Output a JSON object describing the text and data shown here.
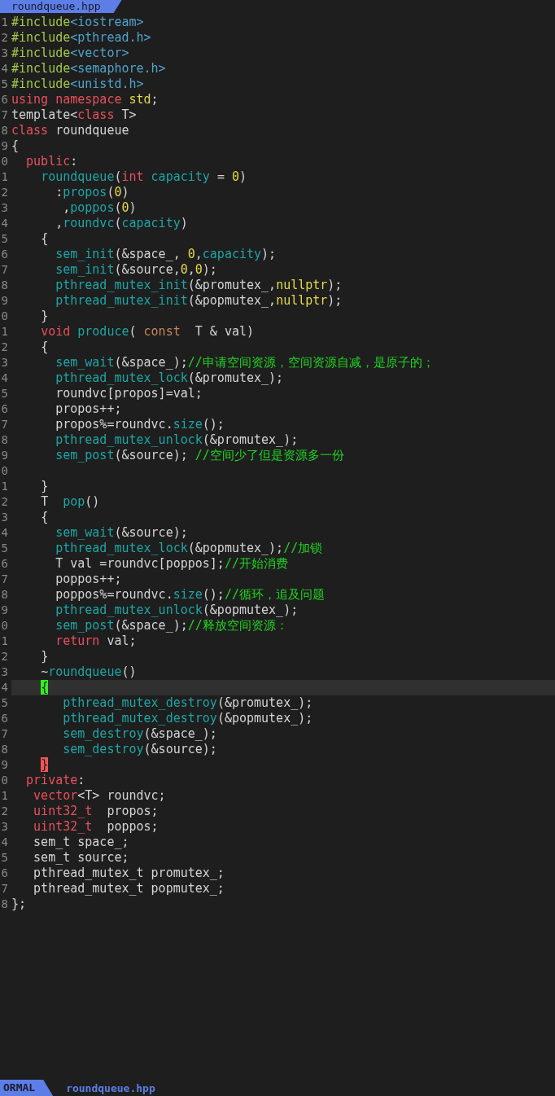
{
  "tab": {
    "label": "roundqueue.hpp"
  },
  "lines": [
    {
      "n": "1",
      "current": false,
      "tokens": [
        {
          "text": "#include",
          "kind": "pp"
        },
        {
          "text": "<iostream>",
          "kind": "inc"
        }
      ]
    },
    {
      "n": "2",
      "current": false,
      "tokens": [
        {
          "text": "#include",
          "kind": "pp"
        },
        {
          "text": "<pthread.h>",
          "kind": "inc"
        }
      ]
    },
    {
      "n": "3",
      "current": false,
      "tokens": [
        {
          "text": "#include",
          "kind": "pp"
        },
        {
          "text": "<vector>",
          "kind": "inc"
        }
      ]
    },
    {
      "n": "4",
      "current": false,
      "tokens": [
        {
          "text": "#include",
          "kind": "pp"
        },
        {
          "text": "<semaphore.h>",
          "kind": "inc"
        }
      ]
    },
    {
      "n": "5",
      "current": false,
      "tokens": [
        {
          "text": "#include",
          "kind": "pp"
        },
        {
          "text": "<unistd.h>",
          "kind": "inc"
        }
      ]
    },
    {
      "n": "6",
      "current": false,
      "tokens": [
        {
          "text": "using",
          "kind": "kw"
        },
        {
          "text": " namespace",
          "kind": "kw"
        },
        {
          "text": " std",
          "kind": "num"
        },
        {
          "text": ";",
          "kind": "p"
        }
      ]
    },
    {
      "n": "7",
      "current": false,
      "tokens": [
        {
          "text": "template<",
          "kind": "p"
        },
        {
          "text": "class",
          "kind": "kw"
        },
        {
          "text": " T>",
          "kind": "p"
        }
      ]
    },
    {
      "n": "8",
      "current": false,
      "tokens": [
        {
          "text": "class",
          "kind": "kw"
        },
        {
          "text": " roundqueue",
          "kind": "p"
        }
      ]
    },
    {
      "n": "9",
      "current": false,
      "tokens": [
        {
          "text": "{",
          "kind": "p"
        }
      ]
    },
    {
      "n": "0",
      "current": false,
      "tokens": [
        {
          "text": "  public",
          "kind": "kw"
        },
        {
          "text": ":",
          "kind": "p"
        }
      ]
    },
    {
      "n": "1",
      "current": false,
      "tokens": [
        {
          "text": "    roundqueue",
          "kind": "fn"
        },
        {
          "text": "(",
          "kind": "p"
        },
        {
          "text": "int",
          "kind": "kw"
        },
        {
          "text": " capacity",
          "kind": "fn"
        },
        {
          "text": " = ",
          "kind": "p"
        },
        {
          "text": "0",
          "kind": "num"
        },
        {
          "text": ")",
          "kind": "p"
        }
      ]
    },
    {
      "n": "2",
      "current": false,
      "tokens": [
        {
          "text": "      :",
          "kind": "p"
        },
        {
          "text": "propos",
          "kind": "fn"
        },
        {
          "text": "(",
          "kind": "p"
        },
        {
          "text": "0",
          "kind": "num"
        },
        {
          "text": ")",
          "kind": "p"
        }
      ]
    },
    {
      "n": "3",
      "current": false,
      "tokens": [
        {
          "text": "       ,",
          "kind": "p"
        },
        {
          "text": "poppos",
          "kind": "fn"
        },
        {
          "text": "(",
          "kind": "p"
        },
        {
          "text": "0",
          "kind": "num"
        },
        {
          "text": ")",
          "kind": "p"
        }
      ]
    },
    {
      "n": "4",
      "current": false,
      "tokens": [
        {
          "text": "      ,",
          "kind": "p"
        },
        {
          "text": "roundvc",
          "kind": "fn"
        },
        {
          "text": "(",
          "kind": "p"
        },
        {
          "text": "capacity",
          "kind": "fn"
        },
        {
          "text": ")",
          "kind": "p"
        }
      ]
    },
    {
      "n": "5",
      "current": false,
      "tokens": [
        {
          "text": "    {",
          "kind": "p"
        }
      ]
    },
    {
      "n": "6",
      "current": false,
      "tokens": [
        {
          "text": "      sem_init",
          "kind": "fn"
        },
        {
          "text": "(&space_, ",
          "kind": "p"
        },
        {
          "text": "0",
          "kind": "num"
        },
        {
          "text": ",",
          "kind": "p"
        },
        {
          "text": "capacity",
          "kind": "fn"
        },
        {
          "text": ");",
          "kind": "p"
        }
      ]
    },
    {
      "n": "7",
      "current": false,
      "tokens": [
        {
          "text": "      sem_init",
          "kind": "fn"
        },
        {
          "text": "(&source,",
          "kind": "p"
        },
        {
          "text": "0",
          "kind": "num"
        },
        {
          "text": ",",
          "kind": "p"
        },
        {
          "text": "0",
          "kind": "num"
        },
        {
          "text": ");",
          "kind": "p"
        }
      ]
    },
    {
      "n": "8",
      "current": false,
      "tokens": [
        {
          "text": "      pthread_mutex_init",
          "kind": "fn"
        },
        {
          "text": "(&promutex_,",
          "kind": "p"
        },
        {
          "text": "nullptr",
          "kind": "num"
        },
        {
          "text": ");",
          "kind": "p"
        }
      ]
    },
    {
      "n": "9",
      "current": false,
      "tokens": [
        {
          "text": "      pthread_mutex_init",
          "kind": "fn"
        },
        {
          "text": "(&popmutex_,",
          "kind": "p"
        },
        {
          "text": "nullptr",
          "kind": "num"
        },
        {
          "text": ");",
          "kind": "p"
        }
      ]
    },
    {
      "n": "0",
      "current": false,
      "tokens": [
        {
          "text": "    }",
          "kind": "p"
        }
      ]
    },
    {
      "n": "1",
      "current": false,
      "tokens": [
        {
          "text": "    void",
          "kind": "kw"
        },
        {
          "text": " produce",
          "kind": "fn"
        },
        {
          "text": "( ",
          "kind": "p"
        },
        {
          "text": "const",
          "kind": "st"
        },
        {
          "text": "  T & val)",
          "kind": "p"
        }
      ]
    },
    {
      "n": "2",
      "current": false,
      "tokens": [
        {
          "text": "    {",
          "kind": "p"
        }
      ]
    },
    {
      "n": "3",
      "current": false,
      "tokens": [
        {
          "text": "      sem_wait",
          "kind": "fn"
        },
        {
          "text": "(&space_);",
          "kind": "p"
        },
        {
          "text": "//申请空间资源，空间资源自减，是原子的；",
          "kind": "cm"
        }
      ]
    },
    {
      "n": "4",
      "current": false,
      "tokens": [
        {
          "text": "      pthread_mutex_lock",
          "kind": "fn"
        },
        {
          "text": "(&promutex_);",
          "kind": "p"
        }
      ]
    },
    {
      "n": "5",
      "current": false,
      "tokens": [
        {
          "text": "      roundvc[propos]=val;",
          "kind": "p"
        }
      ]
    },
    {
      "n": "6",
      "current": false,
      "tokens": [
        {
          "text": "      propos++;",
          "kind": "p"
        }
      ]
    },
    {
      "n": "7",
      "current": false,
      "tokens": [
        {
          "text": "      propos%=roundvc.",
          "kind": "p"
        },
        {
          "text": "size",
          "kind": "fn"
        },
        {
          "text": "();",
          "kind": "p"
        }
      ]
    },
    {
      "n": "8",
      "current": false,
      "tokens": [
        {
          "text": "      pthread_mutex_unlock",
          "kind": "fn"
        },
        {
          "text": "(&promutex_);",
          "kind": "p"
        }
      ]
    },
    {
      "n": "9",
      "current": false,
      "tokens": [
        {
          "text": "      sem_post",
          "kind": "fn"
        },
        {
          "text": "(&source); ",
          "kind": "p"
        },
        {
          "text": "//空间少了但是资源多一份",
          "kind": "cm"
        }
      ]
    },
    {
      "n": "0",
      "current": false
    },
    {
      "n": "1",
      "current": false,
      "tokens": [
        {
          "text": "    }",
          "kind": "p"
        }
      ]
    },
    {
      "n": "2",
      "current": false,
      "tokens": [
        {
          "text": "    T  ",
          "kind": "p"
        },
        {
          "text": "pop",
          "kind": "fn"
        },
        {
          "text": "()",
          "kind": "p"
        }
      ]
    },
    {
      "n": "3",
      "current": false,
      "tokens": [
        {
          "text": "    {",
          "kind": "p"
        }
      ]
    },
    {
      "n": "4",
      "current": false,
      "tokens": [
        {
          "text": "      sem_wait",
          "kind": "fn"
        },
        {
          "text": "(&source);",
          "kind": "p"
        }
      ]
    },
    {
      "n": "5",
      "current": false,
      "tokens": [
        {
          "text": "      pthread_mutex_lock",
          "kind": "fn"
        },
        {
          "text": "(&popmutex_);",
          "kind": "p"
        },
        {
          "text": "//加锁",
          "kind": "cm"
        }
      ]
    },
    {
      "n": "6",
      "current": false,
      "tokens": [
        {
          "text": "      T val =roundvc[poppos];",
          "kind": "p"
        },
        {
          "text": "//开始消费",
          "kind": "cm"
        }
      ]
    },
    {
      "n": "7",
      "current": false,
      "tokens": [
        {
          "text": "      poppos++;",
          "kind": "p"
        }
      ]
    },
    {
      "n": "8",
      "current": false,
      "tokens": [
        {
          "text": "      poppos%=roundvc.",
          "kind": "p"
        },
        {
          "text": "size",
          "kind": "fn"
        },
        {
          "text": "();",
          "kind": "p"
        },
        {
          "text": "//循环，追及问题",
          "kind": "cm"
        }
      ]
    },
    {
      "n": "9",
      "current": false,
      "tokens": [
        {
          "text": "      pthread_mutex_unlock",
          "kind": "fn"
        },
        {
          "text": "(&popmutex_);",
          "kind": "p"
        }
      ]
    },
    {
      "n": "0",
      "current": false,
      "tokens": [
        {
          "text": "      sem_post",
          "kind": "fn"
        },
        {
          "text": "(&space_);",
          "kind": "p"
        },
        {
          "text": "//释放空间资源：",
          "kind": "cm"
        }
      ]
    },
    {
      "n": "1",
      "current": false,
      "tokens": [
        {
          "text": "      return",
          "kind": "kw"
        },
        {
          "text": " val;",
          "kind": "p"
        }
      ]
    },
    {
      "n": "2",
      "current": false,
      "tokens": [
        {
          "text": "    }",
          "kind": "p"
        }
      ]
    },
    {
      "n": "3",
      "current": false,
      "tokens": [
        {
          "text": "    ~",
          "kind": "p"
        },
        {
          "text": "roundqueue",
          "kind": "fn"
        },
        {
          "text": "()",
          "kind": "p"
        }
      ]
    },
    {
      "n": "4",
      "current": true,
      "tokens": [
        {
          "text": "    {",
          "kind": "cursor"
        }
      ]
    },
    {
      "n": "5",
      "current": false,
      "tokens": [
        {
          "text": "       pthread_mutex_destroy",
          "kind": "fn"
        },
        {
          "text": "(&promutex_);",
          "kind": "p"
        }
      ]
    },
    {
      "n": "6",
      "current": false,
      "tokens": [
        {
          "text": "       pthread_mutex_destroy",
          "kind": "fn"
        },
        {
          "text": "(&popmutex_);",
          "kind": "p"
        }
      ]
    },
    {
      "n": "7",
      "current": false,
      "tokens": [
        {
          "text": "       sem_destroy",
          "kind": "fn"
        },
        {
          "text": "(&space_);",
          "kind": "p"
        }
      ]
    },
    {
      "n": "8",
      "current": false,
      "tokens": [
        {
          "text": "       sem_destroy",
          "kind": "fn"
        },
        {
          "text": "(&source);",
          "kind": "p"
        }
      ]
    },
    {
      "n": "9",
      "current": false,
      "tokens": [
        {
          "text": "    }",
          "kind": "match"
        }
      ]
    },
    {
      "n": "0",
      "current": false,
      "tokens": [
        {
          "text": "  private",
          "kind": "kw"
        },
        {
          "text": ":",
          "kind": "p"
        }
      ]
    },
    {
      "n": "1",
      "current": false,
      "tokens": [
        {
          "text": "   vector",
          "kind": "kw"
        },
        {
          "text": "<T> roundvc;",
          "kind": "p"
        }
      ]
    },
    {
      "n": "2",
      "current": false,
      "tokens": [
        {
          "text": "   uint32_t",
          "kind": "kw"
        },
        {
          "text": "  propos;",
          "kind": "p"
        }
      ]
    },
    {
      "n": "3",
      "current": false,
      "tokens": [
        {
          "text": "   uint32_t",
          "kind": "kw"
        },
        {
          "text": "  poppos;",
          "kind": "p"
        }
      ]
    },
    {
      "n": "4",
      "current": false,
      "tokens": [
        {
          "text": "   sem_t space_;",
          "kind": "p"
        }
      ]
    },
    {
      "n": "5",
      "current": false,
      "tokens": [
        {
          "text": "   sem_t source;",
          "kind": "p"
        }
      ]
    },
    {
      "n": "6",
      "current": false,
      "tokens": [
        {
          "text": "   pthread_mutex_t promutex_;",
          "kind": "p"
        }
      ]
    },
    {
      "n": "7",
      "current": false,
      "tokens": [
        {
          "text": "   pthread_mutex_t popmutex_;",
          "kind": "p"
        }
      ]
    },
    {
      "n": "8",
      "current": false,
      "tokens": [
        {
          "text": "};",
          "kind": "p"
        }
      ]
    }
  ],
  "status_bar": {
    "mode": "ORMAL",
    "file": "roundqueue.hpp"
  }
}
